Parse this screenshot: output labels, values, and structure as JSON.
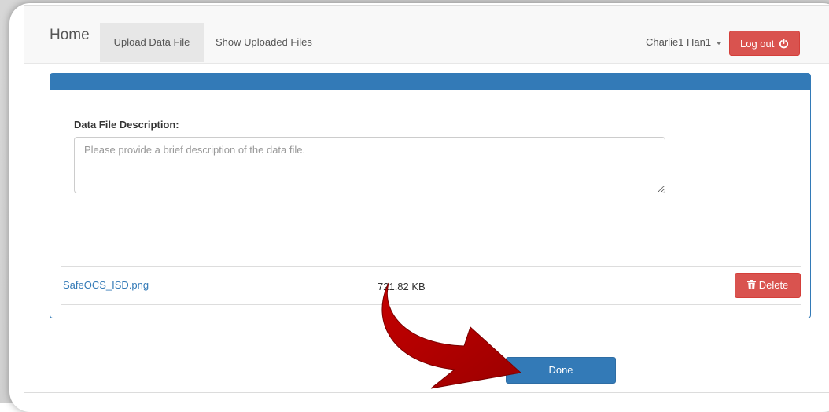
{
  "navbar": {
    "brand": "Home",
    "tabs": [
      {
        "label": "Upload Data File",
        "active": true
      },
      {
        "label": "Show Uploaded Files",
        "active": false
      }
    ],
    "user_name": "Charlie1 Han1",
    "logout_label": "Log out",
    "logout_icon": "power-icon"
  },
  "form": {
    "description_label": "Data File Description:",
    "description_placeholder": "Please provide a brief description of the data file.",
    "description_value": ""
  },
  "files": [
    {
      "name": "SafeOCS_ISD.png",
      "size": "721.82 KB",
      "delete_label": "Delete",
      "delete_icon": "trash-icon"
    }
  ],
  "done_label": "Done",
  "colors": {
    "primary": "#337ab7",
    "danger": "#d9534f",
    "annotation_arrow": "#b30000"
  },
  "annotation": {
    "icon": "curved-arrow-icon"
  }
}
